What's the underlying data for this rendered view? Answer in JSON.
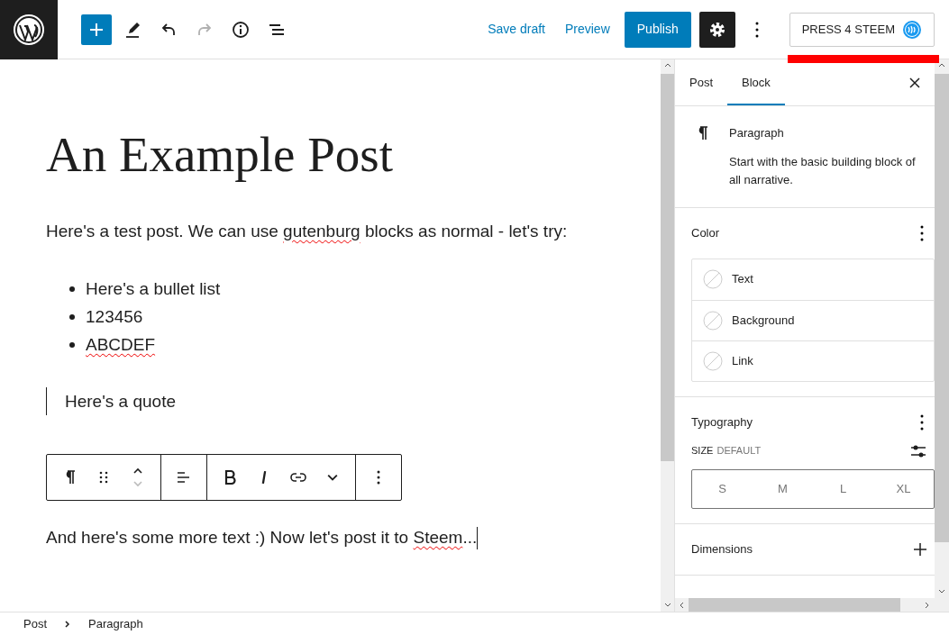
{
  "top_bar": {
    "tools": [
      {
        "kind": "add"
      },
      {
        "kind": "edit"
      },
      {
        "kind": "undo",
        "disabled": false
      },
      {
        "kind": "redo",
        "disabled": true
      },
      {
        "kind": "info"
      },
      {
        "kind": "outline"
      }
    ],
    "save_draft": "Save draft",
    "preview": "Preview",
    "publish": "Publish",
    "plugin_button": "PRESS 4 STEEM"
  },
  "editor": {
    "title": "An Example Post",
    "blocks": [
      {
        "kind": "paragraph",
        "segments": [
          {
            "text": "Here's a test post. We can use ",
            "misspelled": false
          },
          {
            "text": "gutenburg",
            "misspelled": true
          },
          {
            "text": " blocks as normal - let's try:",
            "misspelled": false
          }
        ]
      },
      {
        "kind": "list",
        "items": [
          [
            {
              "text": "Here's a bullet list",
              "misspelled": false
            }
          ],
          [
            {
              "text": "123456",
              "misspelled": false
            }
          ],
          [
            {
              "text": "ABCDEF",
              "misspelled": true
            }
          ]
        ]
      },
      {
        "kind": "quote",
        "segments": [
          {
            "text": "Here's a quote",
            "misspelled": false
          }
        ]
      },
      {
        "kind": "paragraph",
        "segments": [
          {
            "text": "And here's some more text :) Now let's post it to ",
            "misspelled": false
          },
          {
            "text": "Steem",
            "misspelled": true
          },
          {
            "text": "...",
            "misspelled": false
          }
        ]
      }
    ]
  },
  "block_toolbar": {
    "tools": [
      {
        "kind": "paragraph"
      },
      {
        "kind": "drag"
      },
      {
        "kind": "move"
      },
      {
        "kind": "align"
      },
      {
        "kind": "bold"
      },
      {
        "kind": "italic"
      },
      {
        "kind": "link"
      },
      {
        "kind": "more"
      },
      {
        "kind": "options"
      }
    ]
  },
  "sidebar": {
    "tabs": [
      {
        "label": "Post",
        "selected": false
      },
      {
        "label": "Block",
        "selected": true
      }
    ],
    "block_card": {
      "title": "Paragraph",
      "description": "Start with the basic building block of all narrative."
    },
    "color": {
      "title": "Color",
      "items": [
        "Text",
        "Background",
        "Link"
      ]
    },
    "typography": {
      "title": "Typography",
      "size_label": "SIZE",
      "size_value": "DEFAULT",
      "sizes": [
        "S",
        "M",
        "L",
        "XL"
      ]
    },
    "dimensions": {
      "title": "Dimensions"
    }
  },
  "breadcrumb": [
    "Post",
    "Paragraph"
  ]
}
